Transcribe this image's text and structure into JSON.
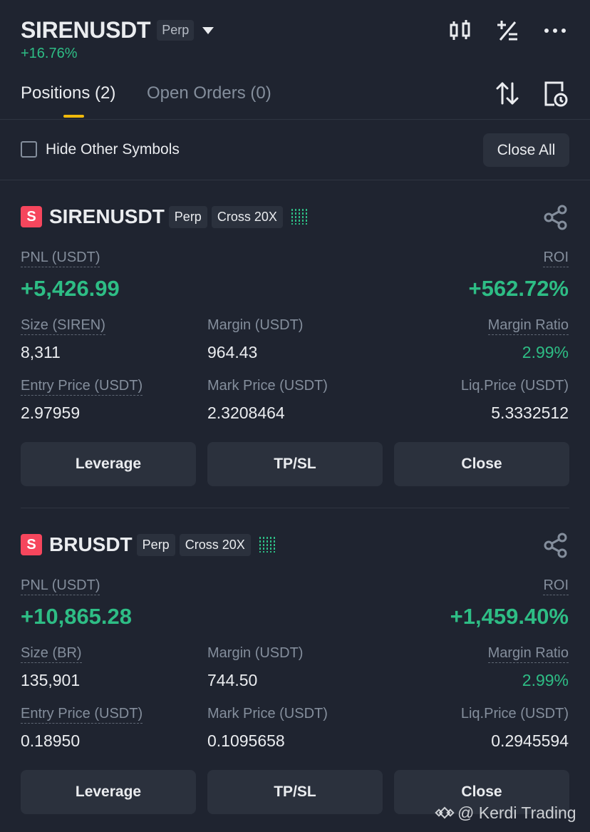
{
  "header": {
    "symbol": "SIRENUSDT",
    "contract_type": "Perp",
    "change": "+16.76%",
    "icons": [
      "candlestick-chart-icon",
      "calculator-icon",
      "more-icon"
    ]
  },
  "tabs": [
    {
      "label": "Positions (2)",
      "active": true
    },
    {
      "label": "Open Orders (0)",
      "active": false
    }
  ],
  "tab_icons": [
    "sort-icon",
    "history-icon"
  ],
  "filter": {
    "checkbox_label": "Hide Other Symbols",
    "checked": false,
    "close_all_label": "Close All"
  },
  "positions": [
    {
      "side": "S",
      "symbol": "SIRENUSDT",
      "type": "Perp",
      "margin_mode": "Cross 20X",
      "pnl_label": "PNL (USDT)",
      "pnl": "+5,426.99",
      "roi_label": "ROI",
      "roi": "+562.72%",
      "size_label": "Size (SIREN)",
      "size": "8,311",
      "margin_label": "Margin (USDT)",
      "margin": "964.43",
      "margin_ratio_label": "Margin Ratio",
      "margin_ratio": "2.99%",
      "entry_label": "Entry Price (USDT)",
      "entry": "2.97959",
      "mark_label": "Mark Price (USDT)",
      "mark": "2.3208464",
      "liq_label": "Liq.Price (USDT)",
      "liq": "5.3332512",
      "buttons": [
        "Leverage",
        "TP/SL",
        "Close"
      ]
    },
    {
      "side": "S",
      "symbol": "BRUSDT",
      "type": "Perp",
      "margin_mode": "Cross 20X",
      "pnl_label": "PNL (USDT)",
      "pnl": "+10,865.28",
      "roi_label": "ROI",
      "roi": "+1,459.40%",
      "size_label": "Size (BR)",
      "size": "135,901",
      "margin_label": "Margin (USDT)",
      "margin": "744.50",
      "margin_ratio_label": "Margin Ratio",
      "margin_ratio": "2.99%",
      "entry_label": "Entry Price (USDT)",
      "entry": "0.18950",
      "mark_label": "Mark Price (USDT)",
      "mark": "0.1095658",
      "liq_label": "Liq.Price (USDT)",
      "liq": "0.2945594",
      "buttons": [
        "Leverage",
        "TP/SL",
        "Close"
      ]
    }
  ],
  "watermark": "@ Kerdi Trading",
  "colors": {
    "background": "#1f2430",
    "green": "#2ebd85",
    "red": "#f6465d",
    "accent": "#f0b90b",
    "button": "#2b313d"
  }
}
